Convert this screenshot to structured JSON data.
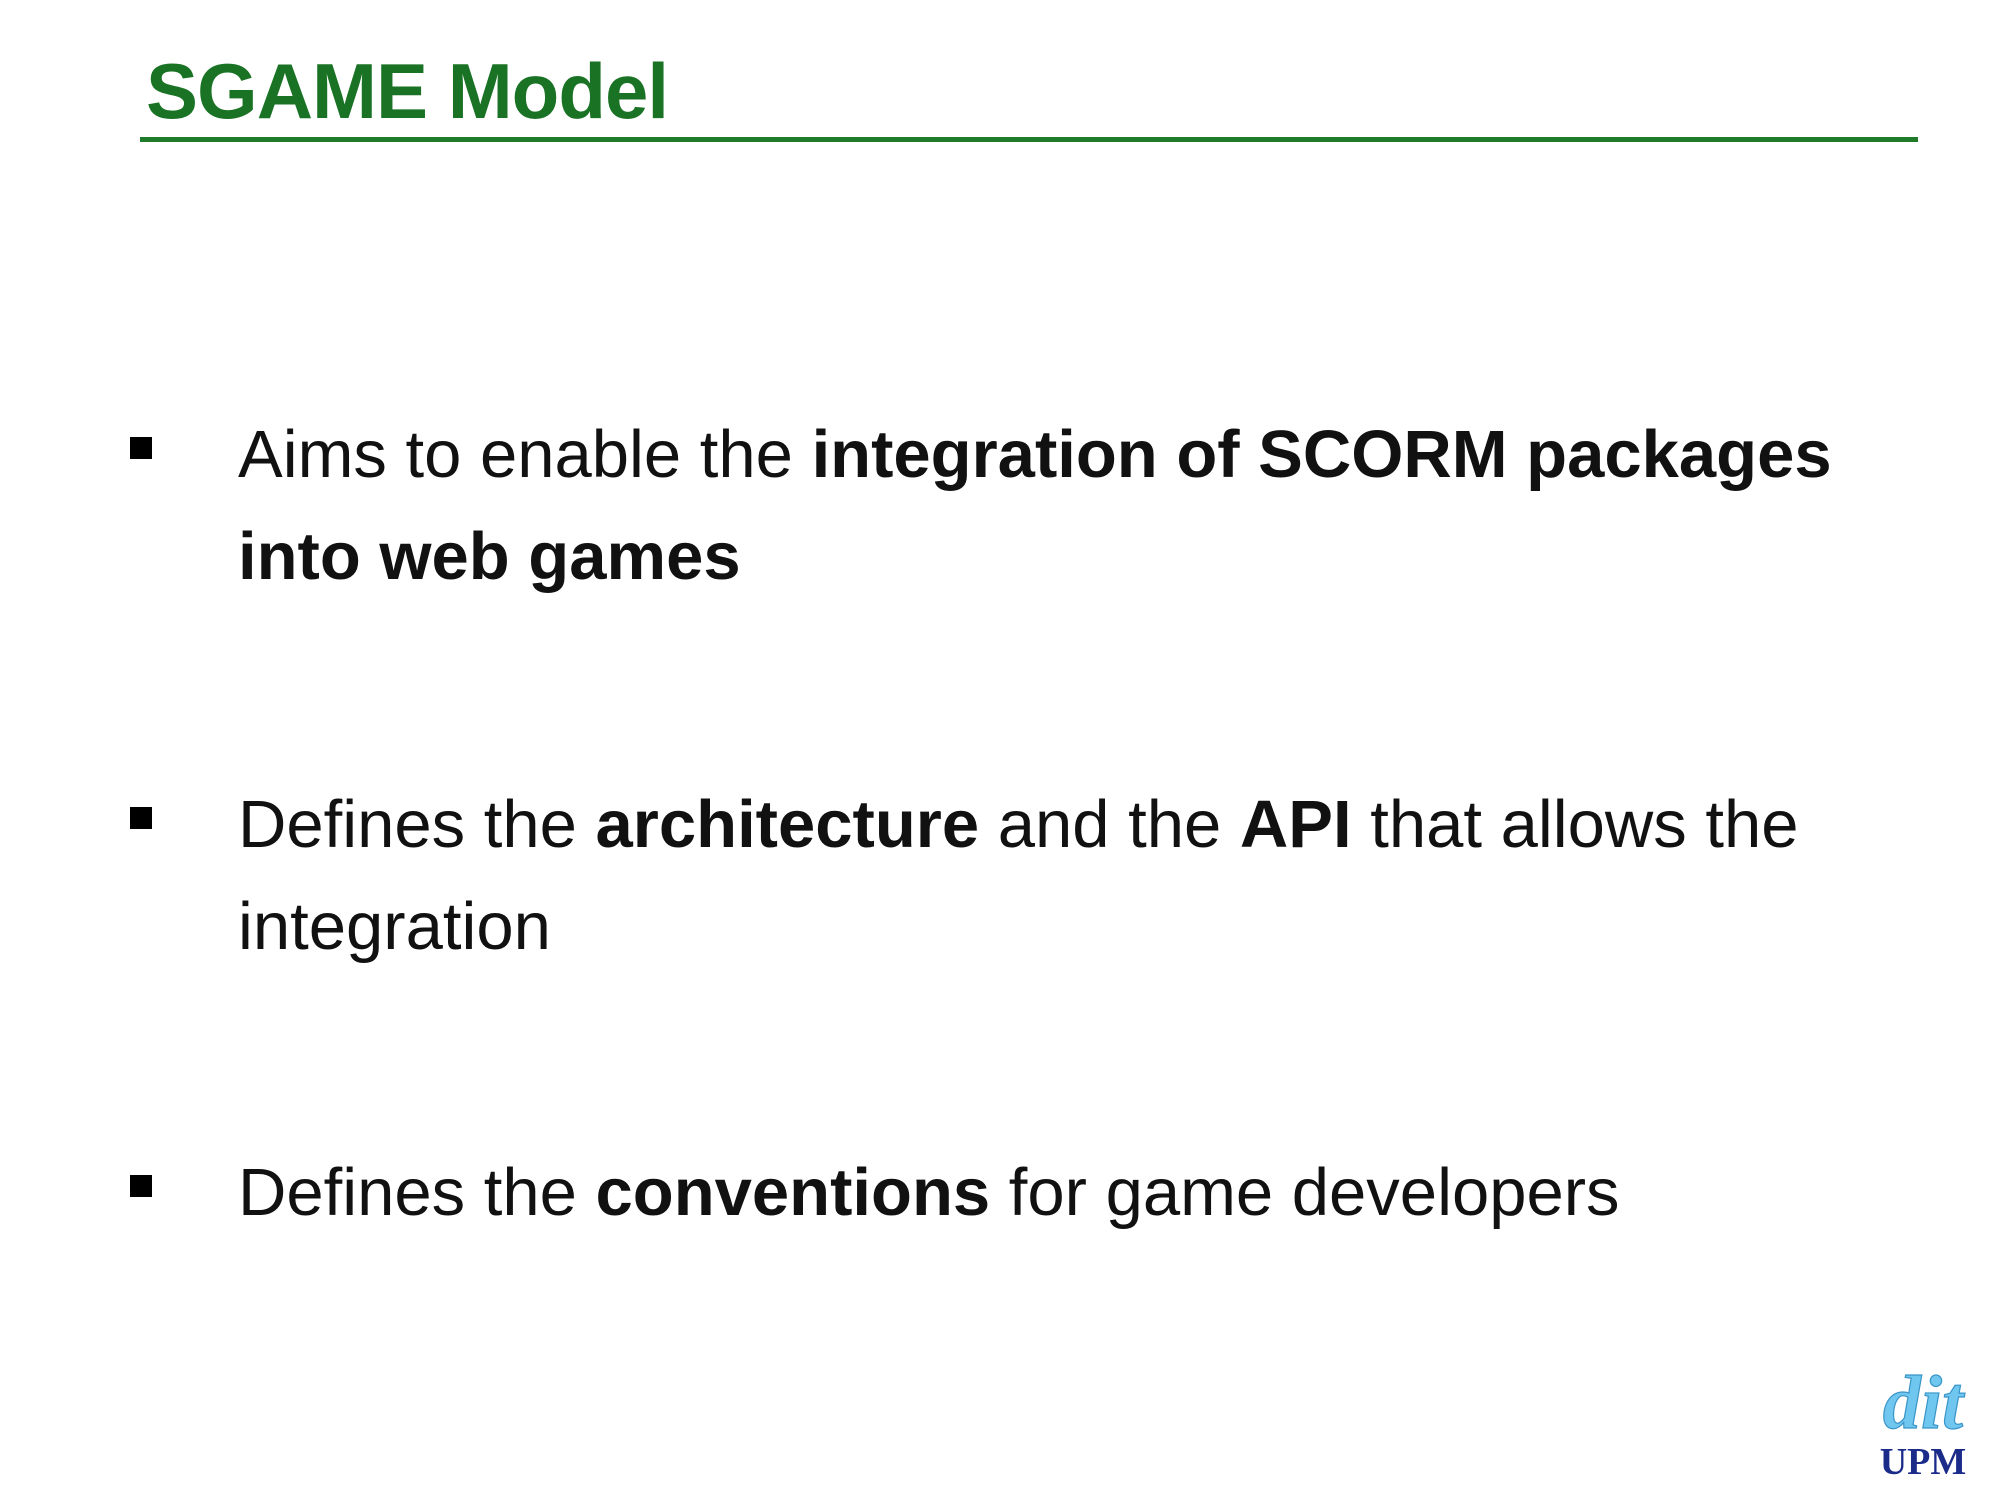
{
  "slide": {
    "title": "SGAME Model"
  },
  "bullets": [
    {
      "segments": [
        {
          "text": "Aims to enable the ",
          "bold": false
        },
        {
          "text": "integration of SCORM packages into web games",
          "bold": true
        }
      ]
    },
    {
      "segments": [
        {
          "text": "Defines the ",
          "bold": false
        },
        {
          "text": "architecture",
          "bold": true
        },
        {
          "text": " and the ",
          "bold": false
        },
        {
          "text": "API",
          "bold": true
        },
        {
          "text": " that allows the integration",
          "bold": false
        }
      ]
    },
    {
      "segments": [
        {
          "text": "Defines the ",
          "bold": false
        },
        {
          "text": "conventions",
          "bold": true
        },
        {
          "text": " for game developers",
          "bold": false
        }
      ]
    }
  ],
  "logo": {
    "top_text": "dit",
    "bottom_text": "UPM"
  },
  "colors": {
    "title": "#1a7325",
    "rule": "#1f7a2a",
    "logo_top": "#6fc6ee",
    "logo_bottom": "#1a2b8a",
    "body_text": "#111111"
  }
}
